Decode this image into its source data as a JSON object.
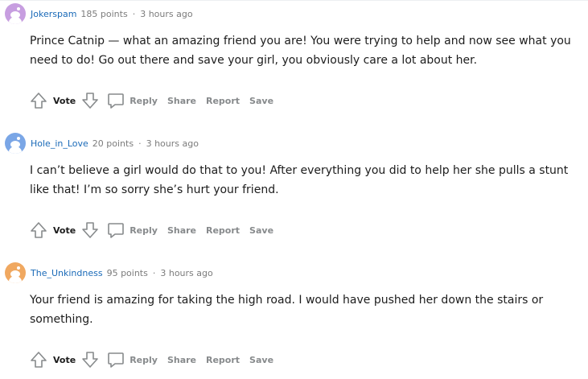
{
  "comments": [
    {
      "username": "Jokerspam",
      "points": "185 points",
      "separator": "·",
      "time": "3 hours ago",
      "avatar_color": "#c79ee0",
      "text": "Prince Catnip — what an amazing friend you are! You were trying to help and now see what you need to do! Go out there and save your girl, you obviously care a lot about her.",
      "vote_label": "Vote",
      "reply_label": "Reply",
      "share_label": "Share",
      "report_label": "Report",
      "save_label": "Save"
    },
    {
      "username": "Hole_in_Love",
      "points": "20 points",
      "separator": "·",
      "time": "3 hours ago",
      "avatar_color": "#7aa6e6",
      "text": "I can’t believe a girl would do that to you! After everything you did to help her she pulls a stunt like that! I’m so sorry she’s hurt your friend.",
      "vote_label": "Vote",
      "reply_label": "Reply",
      "share_label": "Share",
      "report_label": "Report",
      "save_label": "Save"
    },
    {
      "username": "The_Unkindness",
      "points": "95 points",
      "separator": "·",
      "time": "3 hours ago",
      "avatar_color": "#f0a860",
      "text": "Your friend is amazing for taking the high road. I would have pushed her down the stairs or something.",
      "vote_label": "Vote",
      "reply_label": "Reply",
      "share_label": "Share",
      "report_label": "Report",
      "save_label": "Save"
    }
  ],
  "icons": {
    "upvote": "upvote-arrow-icon",
    "downvote": "downvote-arrow-icon",
    "reply": "speech-bubble-icon",
    "avatar": "reddit-snoo-avatar-icon"
  }
}
